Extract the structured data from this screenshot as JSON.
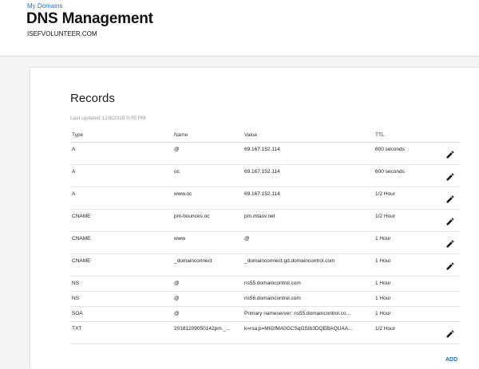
{
  "header": {
    "breadcrumb": "My Domains",
    "title": "DNS Management",
    "domain": "ISEFVOLUNTEER.COM"
  },
  "records": {
    "title": "Records",
    "last_updated": "Last updated 12/8/2018 9:05 PM",
    "columns": {
      "type": "Type",
      "name": "Name",
      "value": "Value",
      "ttl": "TTL"
    },
    "rows": [
      {
        "type": "A",
        "name": "@",
        "value": "69.167.152.114",
        "ttl": "600 seconds",
        "editable": true
      },
      {
        "type": "A",
        "name": "oc",
        "value": "69.167.152.114",
        "ttl": "600 seconds",
        "editable": true
      },
      {
        "type": "A",
        "name": "www.oc",
        "value": "69.167.152.114",
        "ttl": "1/2 Hour",
        "editable": true
      },
      {
        "type": "CNAME",
        "name": "pm-bounces.oc",
        "value": "pm.mtasv.net",
        "ttl": "1/2 Hour",
        "editable": true
      },
      {
        "type": "CNAME",
        "name": "www",
        "value": "@",
        "ttl": "1 Hour",
        "editable": true
      },
      {
        "type": "CNAME",
        "name": "_domainconnect",
        "value": "_domainconnect.gd.domaincontrol.com",
        "ttl": "1 Hour",
        "editable": true
      },
      {
        "type": "NS",
        "name": "@",
        "value": "ns55.domaincontrol.com",
        "ttl": "1 Hour",
        "editable": false
      },
      {
        "type": "NS",
        "name": "@",
        "value": "ns56.domaincontrol.com",
        "ttl": "1 Hour",
        "editable": false
      },
      {
        "type": "SOA",
        "name": "@",
        "value": "Primary nameserver: ns55.domaincontrol.co...",
        "ttl": "1 Hour",
        "editable": false
      },
      {
        "type": "TXT",
        "name": "20181209050142pm._...",
        "value": "k=rsa;p=MIGfMA0GCSqGSIb3DQEBAQUAA...",
        "ttl": "1/2 Hour",
        "editable": true
      }
    ],
    "add_label": "ADD",
    "edit_icon": "pencil-icon",
    "accent_color": "#1e6fd0"
  }
}
